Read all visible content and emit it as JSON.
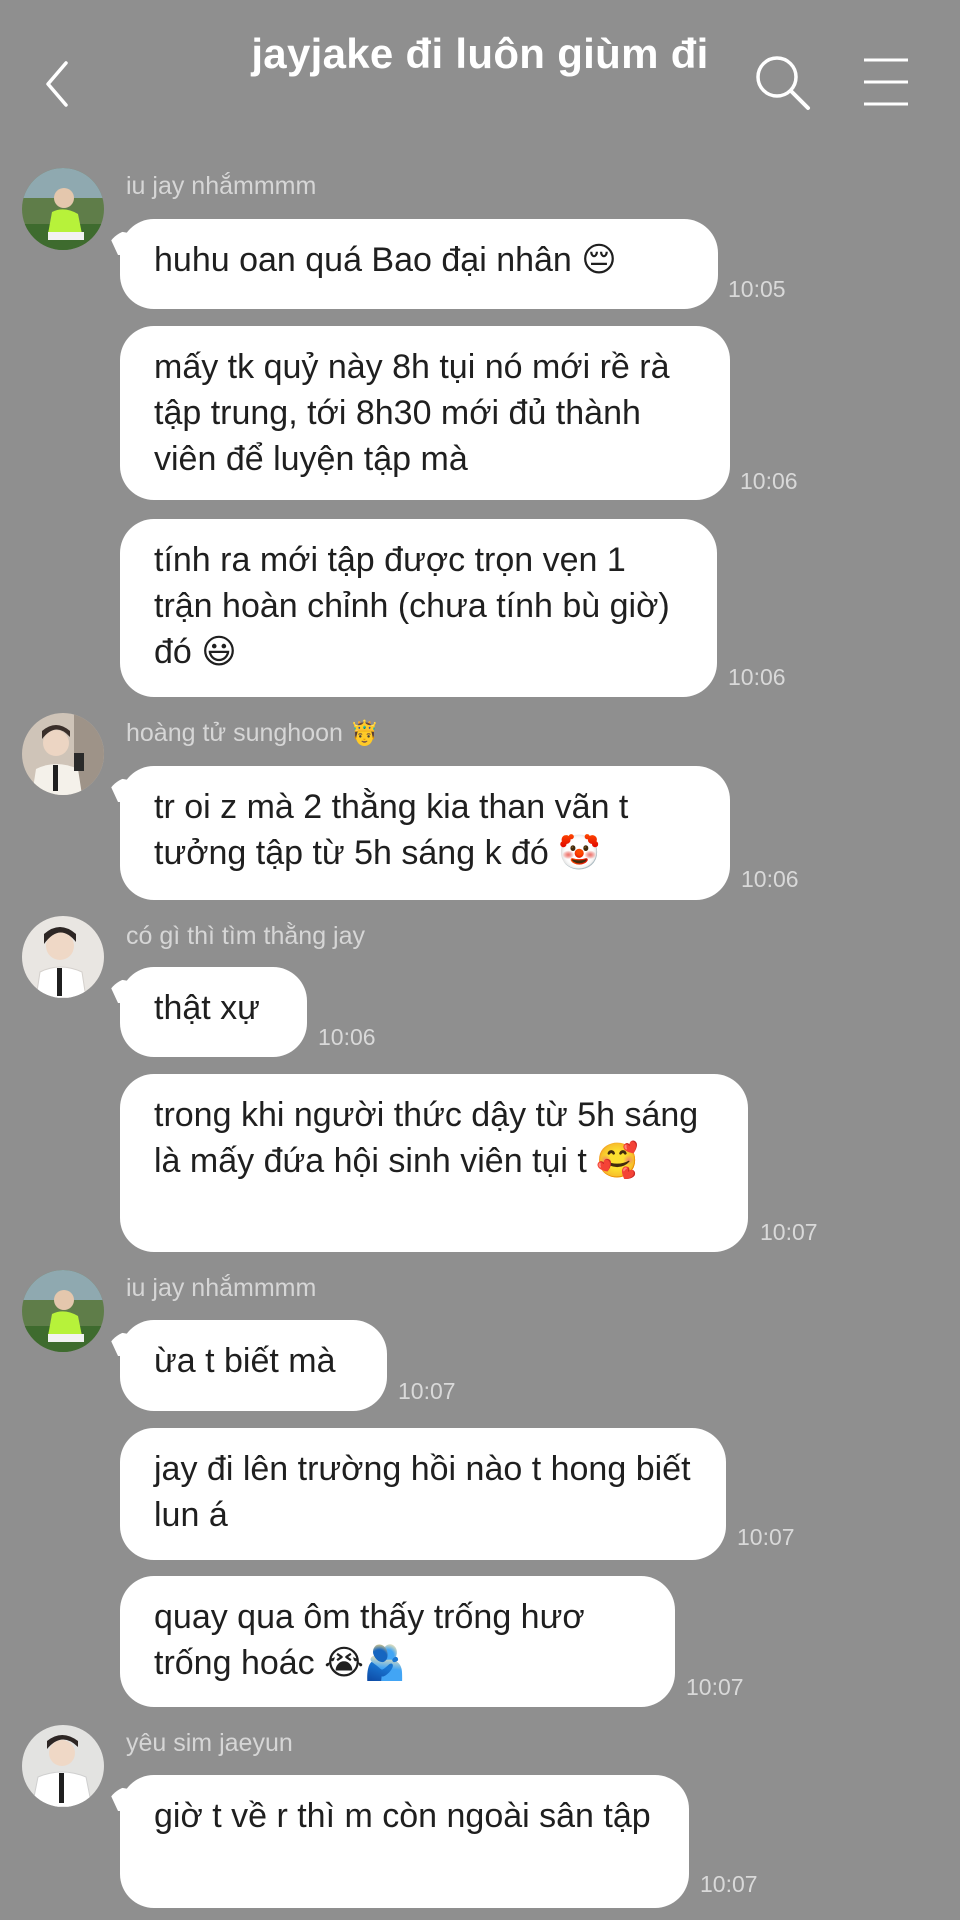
{
  "header": {
    "title": "jayjake đi luôn giùm đi"
  },
  "messages": [
    {
      "sender": "iu jay nhắmmmm",
      "text": "huhu oan quá Bao đại nhân 😔",
      "time": "10:05"
    },
    {
      "sender": "",
      "text": "mấy tk quỷ này 8h tụi nó mới rề rà tập trung, tới 8h30 mới đủ thành viên để luyện tập mà",
      "time": "10:06"
    },
    {
      "sender": "",
      "text": "tính ra mới tập được trọn vẹn 1 trận hoàn chỉnh (chưa tính bù giờ) đó 😃",
      "time": "10:06"
    },
    {
      "sender": "hoàng tử sunghoon",
      "sender_emoji": "🤴",
      "text": "tr oi z mà 2 thằng kia than vãn t tưởng tập từ 5h sáng k đó 🤡",
      "time": "10:06"
    },
    {
      "sender": "có gì thì tìm thằng jay",
      "text": "thật xự",
      "time": "10:06"
    },
    {
      "sender": "",
      "text": "trong khi người thức dậy từ 5h sáng là mấy đứa hội sinh viên tụi t 🥰",
      "time": "10:07"
    },
    {
      "sender": "iu jay nhắmmmm",
      "text": "ừa t biết mà",
      "time": "10:07"
    },
    {
      "sender": "",
      "text": "jay đi lên trường hồi nào t hong biết lun á",
      "time": "10:07"
    },
    {
      "sender": "",
      "text": "quay qua ôm thấy trống hươ trống hoác 😭🫂",
      "time": "10:07"
    },
    {
      "sender": "yêu sim jaeyun",
      "text": "giờ t về r thì m còn ngoài sân tập",
      "time": "10:07"
    }
  ],
  "colors": {
    "background": "#8f8f8f",
    "bubble": "#ffffff",
    "text": "#1f1f1f",
    "meta": "#d9d9d9"
  }
}
